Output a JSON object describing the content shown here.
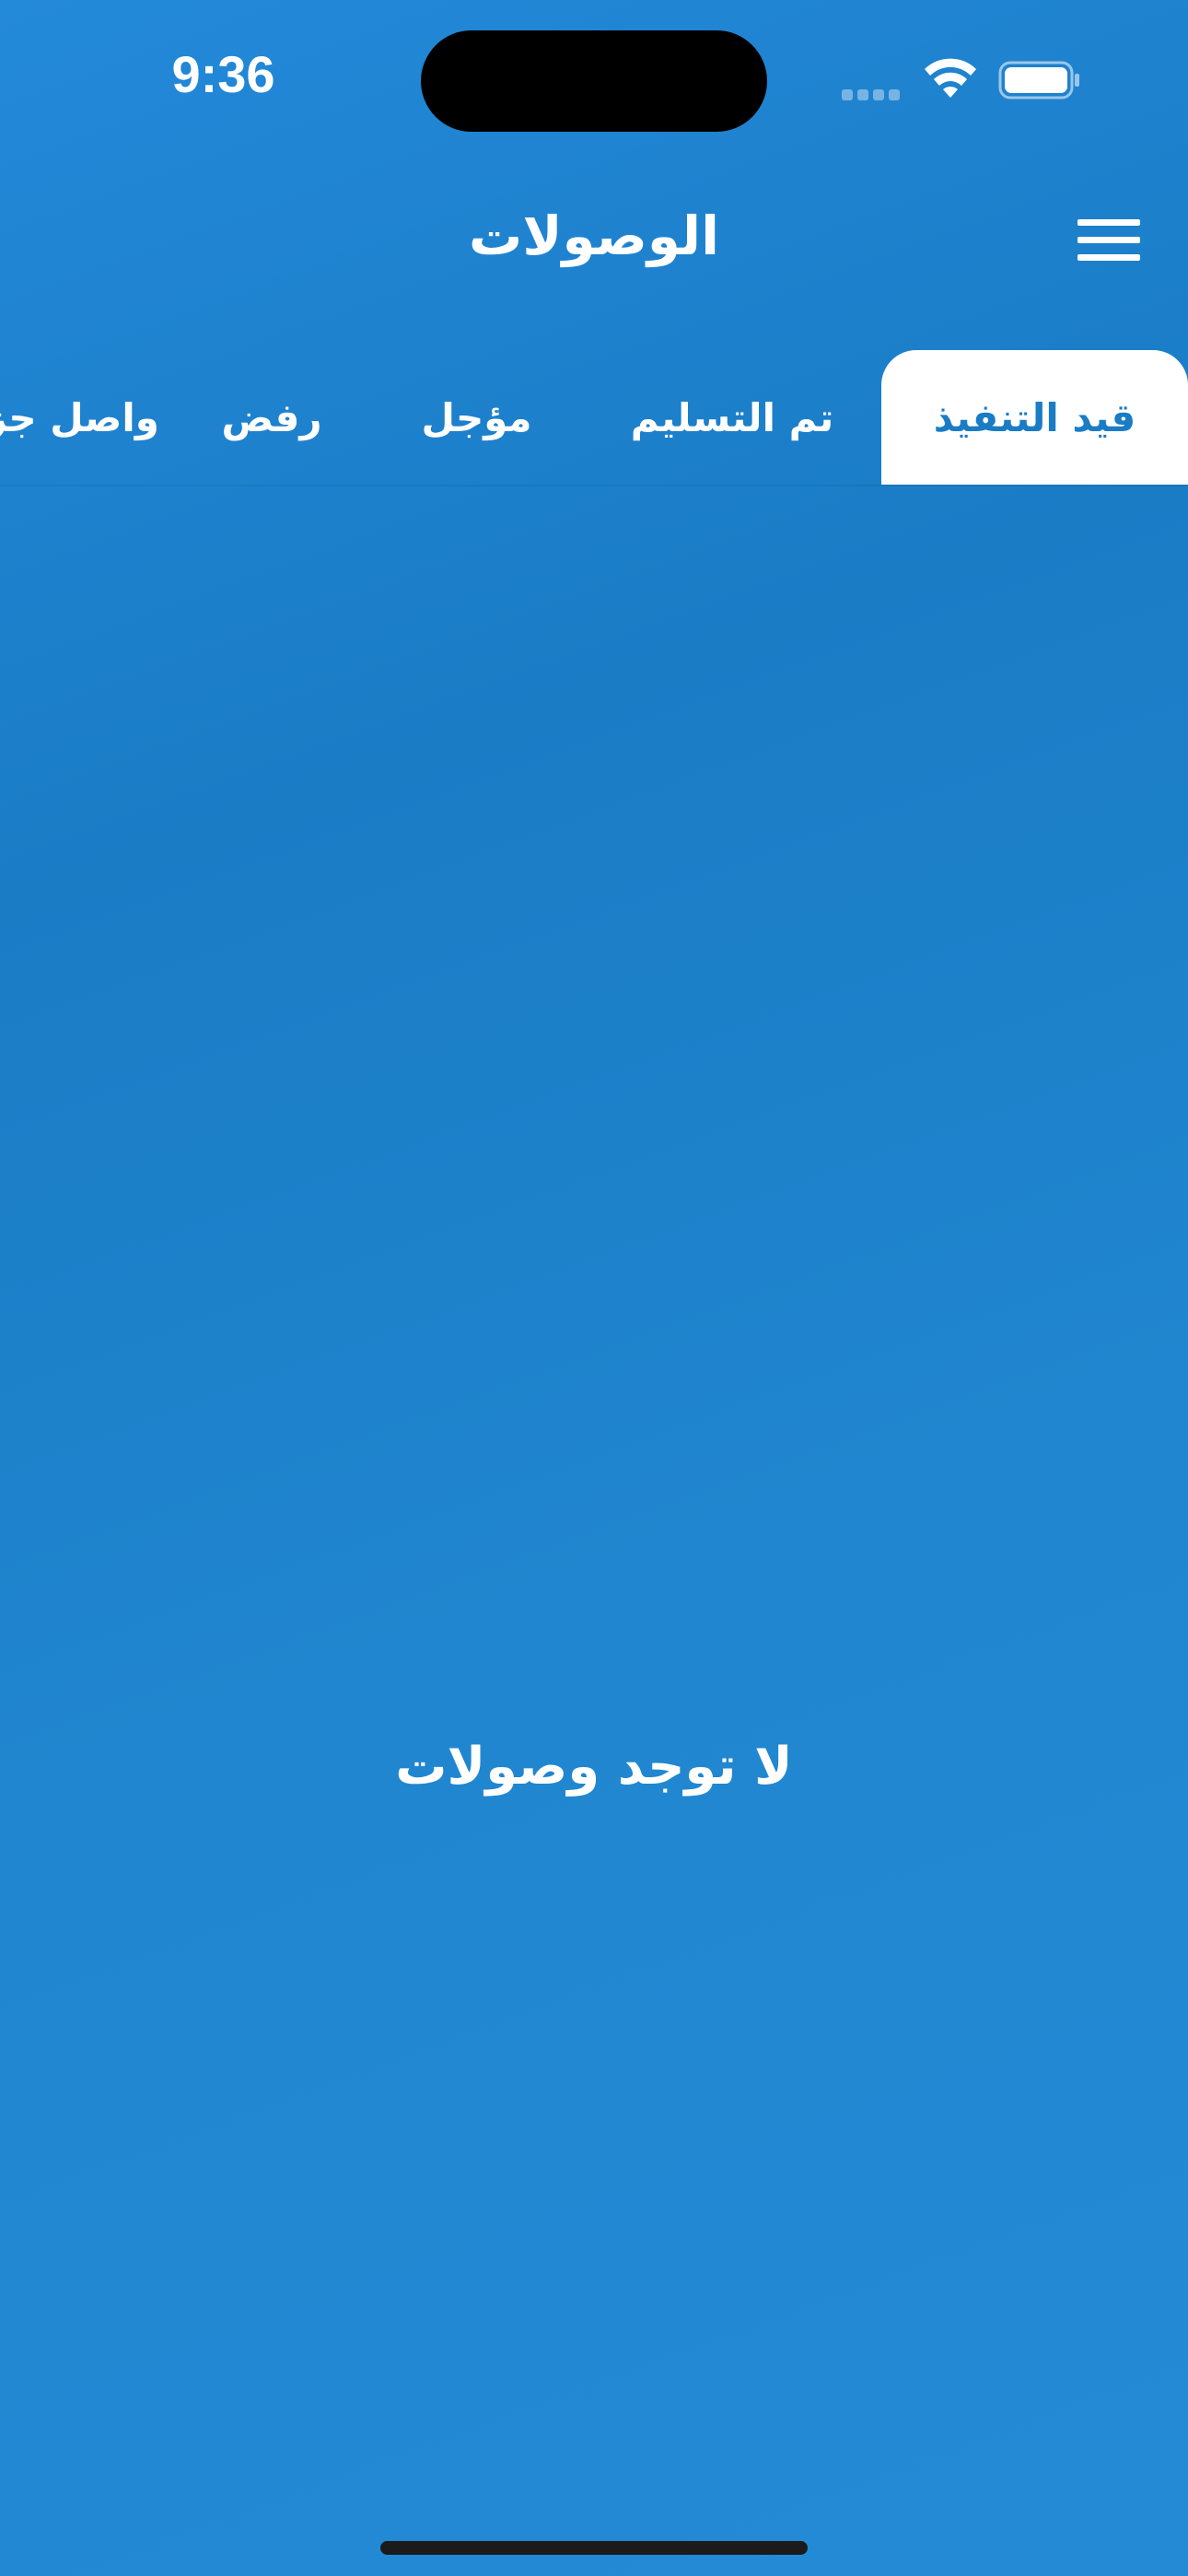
{
  "status_bar": {
    "time": "9:36",
    "wifi_icon": "wifi-icon",
    "battery_icon": "battery-icon",
    "signal_icon": "cellular-signal-icon"
  },
  "header": {
    "title": "الوصولات",
    "menu_icon": "hamburger-menu-icon"
  },
  "tabs": [
    {
      "label": "قيد التنفيذ",
      "active": true
    },
    {
      "label": "تم التسليم",
      "active": false
    },
    {
      "label": "مؤجل",
      "active": false
    },
    {
      "label": "رفض",
      "active": false
    },
    {
      "label": "واصل جزئي",
      "active": false
    }
  ],
  "empty_state": {
    "message": "لا توجد وصولات"
  },
  "colors": {
    "background": "#1f82cc",
    "active_tab_bg": "#ffffff",
    "active_tab_text": "#1a7cc5",
    "text": "#ffffff"
  }
}
